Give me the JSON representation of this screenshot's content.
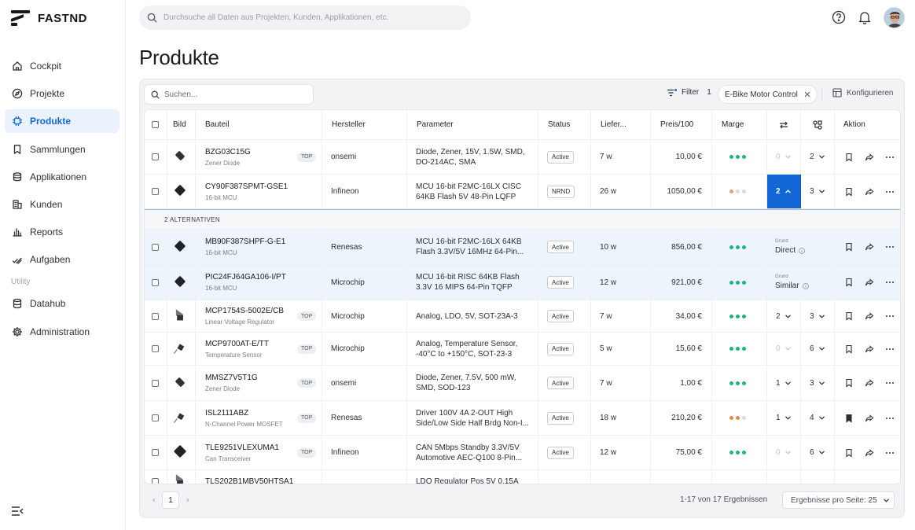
{
  "brand": {
    "name": "FASTND"
  },
  "sidebar": {
    "items": [
      {
        "label": "Cockpit",
        "icon": "home-icon"
      },
      {
        "label": "Projekte",
        "icon": "compass-icon"
      },
      {
        "label": "Produkte",
        "icon": "chip-icon",
        "active": true
      },
      {
        "label": "Sammlungen",
        "icon": "bookmark-icon"
      },
      {
        "label": "Applikationen",
        "icon": "cylinder-icon"
      },
      {
        "label": "Kunden",
        "icon": "building-icon"
      },
      {
        "label": "Reports",
        "icon": "bar-chart-icon"
      },
      {
        "label": "Aufgaben",
        "icon": "checklist-icon"
      }
    ],
    "section_label": "Utility",
    "utility_items": [
      {
        "label": "Datahub",
        "icon": "database-icon"
      },
      {
        "label": "Administration",
        "icon": "gear-icon"
      }
    ]
  },
  "header": {
    "search_placeholder": "Durchsuche all Daten aus Projekten, Kunden, Applikationen, etc."
  },
  "page": {
    "title": "Produkte"
  },
  "toolbar": {
    "search_placeholder": "Suchen...",
    "filter_label": "Filter",
    "filter_count": "1",
    "chip_label": "E-Bike Motor Control",
    "configure_label": "Konfigurieren"
  },
  "table": {
    "columns": [
      "Bild",
      "Bauteil",
      "Hersteller",
      "Parameter",
      "Status",
      "Liefer...",
      "Preis/100",
      "Marge",
      "Aktion"
    ],
    "alternatives_label": "2 ALTERNATIVEN",
    "rows": [
      {
        "name": "BZG03C15G",
        "category": "Zener Diode",
        "top": "TOP",
        "maker": "onsemi",
        "params": "Diode, Zener, 15V, 1.5W, SMD,\nDO-214AC, SMA",
        "status": "Active",
        "lead": "7 w",
        "price": "10,00 €",
        "margin": "high",
        "alt": "0",
        "alt_disabled": true,
        "sim": "2"
      },
      {
        "name": "CY90F387SPMT-GSE1",
        "category": "16-bit MCU",
        "top": "",
        "maker": "Infineon",
        "params": "MCU 16-bit F2MC-16LX CISC\n64KB Flash 5V 48-Pin LQFP",
        "status": "NRND",
        "lead": "26 w",
        "price": "1050,00 €",
        "margin": "low",
        "alt": "2",
        "alt_active": true,
        "sim": "3"
      },
      {
        "name": "MB90F387SHPF-G-E1",
        "category": "16-bit MCU",
        "top": "",
        "maker": "Renesas",
        "params": "MCU 16-bit F2MC-16LX 64KB\nFlash 3.3V/5V 16MHz 64-Pin...",
        "status": "Active",
        "lead": "10 w",
        "price": "856,00 €",
        "margin": "high",
        "reason_label": "Grund",
        "reason": "Direct"
      },
      {
        "name": "PIC24FJ64GA106-I/PT",
        "category": "16-bit MCU",
        "top": "",
        "maker": "Microchip",
        "params": "MCU 16-bit RISC 64KB Flash\n3.3V 16 MIPS 64-Pin TQFP",
        "status": "Active",
        "lead": "12 w",
        "price": "921,00 €",
        "margin": "high",
        "reason_label": "Grund",
        "reason": "Similar"
      },
      {
        "name": "MCP1754S-5002E/CB",
        "category": "Linear Voltage Regulator",
        "top": "TOP",
        "maker": "Microchip",
        "params": "Analog, LDO, 5V, SOT-23A-3",
        "status": "Active",
        "lead": "7 w",
        "price": "34,00 €",
        "margin": "high",
        "alt": "2",
        "sim": "3"
      },
      {
        "name": "MCP9700AT-E/TT",
        "category": "Temperature Sensor",
        "top": "TOP",
        "maker": "Microchip",
        "params": "Analog, Temperature Sensor,\n-40°C to +150°C, SOT-23-3",
        "status": "Active",
        "lead": "5 w",
        "price": "15,60 €",
        "margin": "high",
        "alt": "0",
        "alt_disabled": true,
        "sim": "6"
      },
      {
        "name": "MMSZ7V5T1G",
        "category": "Zener Diode",
        "top": "TOP",
        "maker": "onsemi",
        "params": "Diode, Zener, 7.5V, 500 mW,\nSMD, SOD-123",
        "status": "Active",
        "lead": "7 w",
        "price": "1,00 €",
        "margin": "high",
        "alt": "1",
        "sim": "3"
      },
      {
        "name": "ISL2111ABZ",
        "category": "N-Channel Power MOSFET",
        "top": "TOP",
        "maker": "Renesas",
        "params": "Driver 100V 4A 2-OUT High\nSide/Low Side Half Brdg Non-I...",
        "status": "Active",
        "lead": "18 w",
        "price": "210,20 €",
        "margin": "mid",
        "alt": "1",
        "sim": "4",
        "bookmarked": true
      },
      {
        "name": "TLE9251VLEXUMA1",
        "category": "Can Transceiver",
        "top": "TOP",
        "maker": "Infineon",
        "params": "CAN 5Mbps Standby 3.3V/5V\nAutomotive AEC-Q100 8-Pin...",
        "status": "Active",
        "lead": "12 w",
        "price": "75,00 €",
        "margin": "high",
        "alt": "0",
        "alt_disabled": true,
        "sim": "6"
      },
      {
        "name": "TLS202B1MBV50HTSA1",
        "category": "",
        "top": "",
        "maker": "",
        "params": "LDO Regulator Pos 5V 0.15A",
        "status": "",
        "lead": "",
        "price": "",
        "margin": "",
        "partial": true
      }
    ]
  },
  "pagination": {
    "prev": "‹",
    "next": "›",
    "page": "1",
    "info": "1-17 von 17 Ergebnissen",
    "page_size_label": "Ergebnisse pro Seite: 25"
  },
  "colors": {
    "accent": "#1366d6",
    "margin_high": "#1db57c",
    "margin_mid": "#e08a4a",
    "margin_low": "#d5d8dc"
  }
}
